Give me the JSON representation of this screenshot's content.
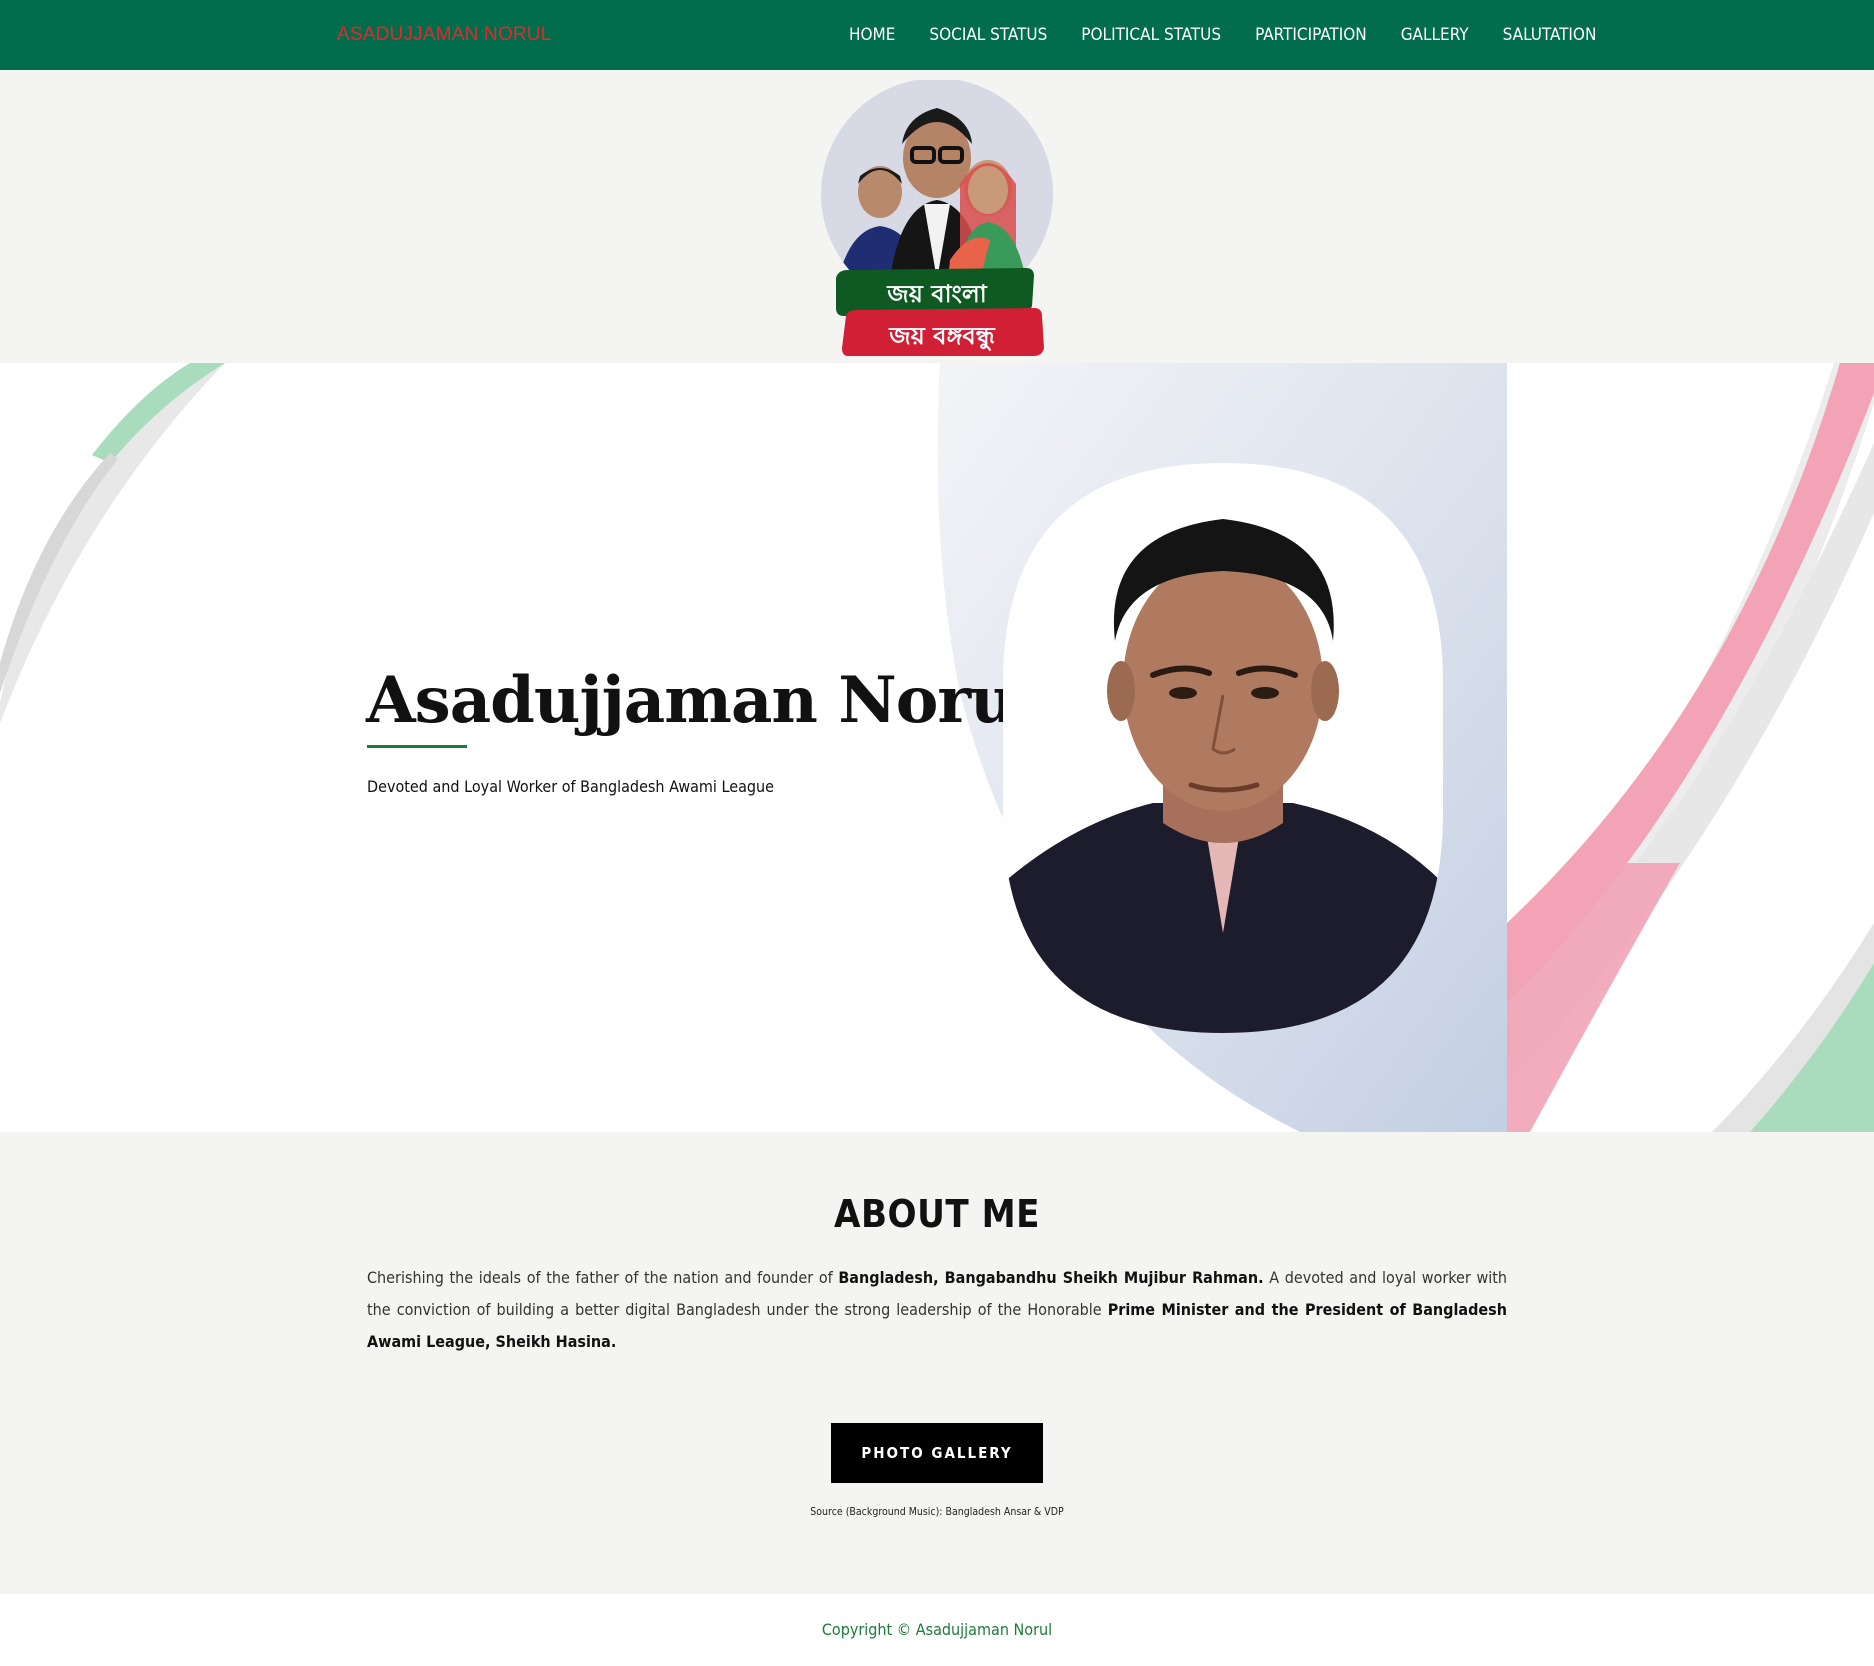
{
  "brand": {
    "name": "ASADUJJAMAN NORUL"
  },
  "nav": {
    "items": [
      {
        "label": "HOME"
      },
      {
        "label": "SOCIAL STATUS"
      },
      {
        "label": "POLITICAL STATUS"
      },
      {
        "label": "PARTICIPATION"
      },
      {
        "label": "GALLERY"
      },
      {
        "label": "SALUTATION"
      }
    ]
  },
  "emblem": {
    "line1": "জয় বাংলা",
    "line2": "জয় বঙ্গবন্ধু"
  },
  "hero": {
    "title": "Asadujjaman Norul",
    "subtitle": "Devoted and Loyal Worker of Bangladesh Awami League"
  },
  "about": {
    "title": "ABOUT ME",
    "p1": "Cherishing the ideals of the father of the nation and founder of ",
    "p1_bold": "Bangladesh, Bangabandhu Sheikh Mujibur Rahman.",
    "p2": " A devoted and loyal worker with the conviction of building a better digital Bangladesh under the strong leadership of the Honorable ",
    "p2_bold": "Prime Minister and the President of Bangladesh Awami League, Sheikh Hasina.",
    "button_label": "PHOTO GALLERY",
    "source_note": "Source (Background Music): Bangladesh Ansar & VDP"
  },
  "footer": {
    "copyright": "Copyright © Asadujjaman Norul"
  },
  "colors": {
    "nav_bg": "#016d4c",
    "brand": "#e8262c",
    "accent_green": "#1e7a3c",
    "flag_red": "#e0264a",
    "flag_green": "#0f6b2c"
  }
}
